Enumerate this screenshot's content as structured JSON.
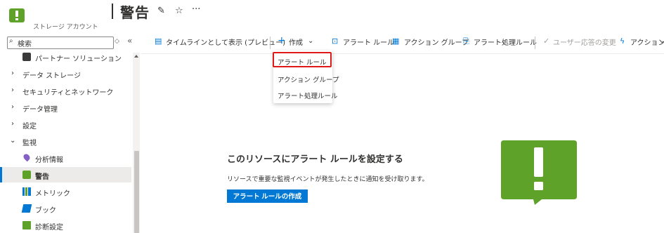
{
  "header": {
    "resource_subtitle": "ストレージ アカウント",
    "page_title": "警告",
    "pin_icon": "pin-icon",
    "favorite_icon": "star-icon",
    "more_icon": "ellipsis-icon"
  },
  "sidebar": {
    "search_placeholder": "検索",
    "search_options": "◇",
    "collapse_glyph": "«",
    "items": [
      {
        "label": "パートナー ソリューション",
        "icon": "partner-solutions-icon"
      },
      {
        "label": "データ ストレージ",
        "expandable": true
      },
      {
        "label": "セキュリティとネットワーク",
        "expandable": true
      },
      {
        "label": "データ管理",
        "expandable": true
      },
      {
        "label": "設定",
        "expandable": true
      },
      {
        "label": "監視",
        "expandable": true,
        "expanded": true
      },
      {
        "label": "分析情報",
        "icon": "insights-pin-icon"
      },
      {
        "label": "警告",
        "icon": "alert-icon",
        "active": true
      },
      {
        "label": "メトリック",
        "icon": "metrics-icon"
      },
      {
        "label": "ブック",
        "icon": "workbooks-icon"
      },
      {
        "label": "診断設定",
        "icon": "diagnostic-settings-icon"
      }
    ]
  },
  "toolbar": {
    "timeline": "タイムラインとして表示 (プレビュー)",
    "create": "作成",
    "alert_rules": "アラート ルール",
    "action_groups": "アクション グループ",
    "alert_processing_rules": "アラート処理ルール",
    "change_user_response": "ユーザー応答の変更",
    "actions": "アクション"
  },
  "create_menu": {
    "items": [
      "アラート ルール",
      "アクション グループ",
      "アラート処理ルール"
    ]
  },
  "empty_state": {
    "title": "このリソースにアラート ルールを設定する",
    "description": "リソースで重要な監視イベントが発生したときに通知を受け取ります。",
    "button": "アラート ルールの作成"
  },
  "colors": {
    "accent": "#0078d4",
    "alert_green": "#5ea229",
    "highlight": "#e01818"
  }
}
